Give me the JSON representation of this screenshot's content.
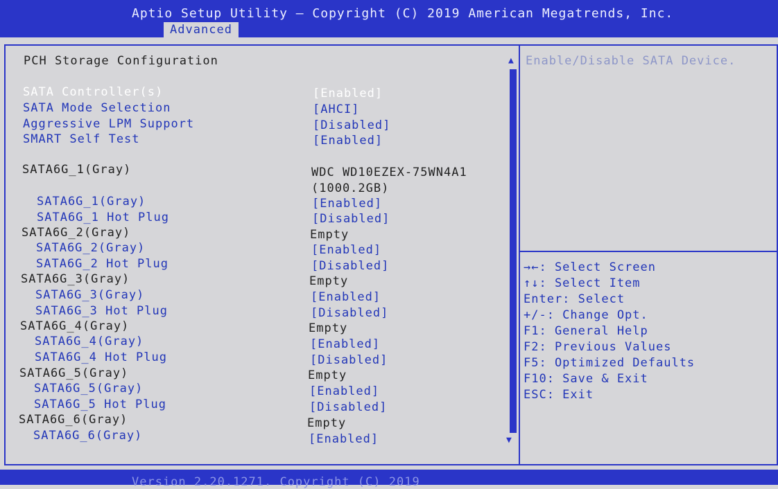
{
  "header": {
    "title": "Aptio Setup Utility – Copyright (C) 2019 American Megatrends, Inc.",
    "active_tab": "Advanced"
  },
  "page": {
    "heading": "PCH Storage Configuration"
  },
  "settings": [
    {
      "label": "SATA Controller(s)",
      "value": "[Enabled]"
    },
    {
      "label": "SATA Mode Selection",
      "value": "[AHCI]"
    },
    {
      "label": "Aggressive LPM Support",
      "value": "[Disabled]"
    },
    {
      "label": "SMART Self Test",
      "value": "[Enabled]"
    },
    {
      "label": "SATA6G_1(Gray)",
      "value": "WDC WD10EZEX-75WN4A1",
      "value2": "(1000.2GB)"
    },
    {
      "label": "SATA6G_1(Gray)",
      "value": "[Enabled]"
    },
    {
      "label": "SATA6G_1 Hot Plug",
      "value": "[Disabled]"
    },
    {
      "label": "SATA6G_2(Gray)",
      "value": "Empty"
    },
    {
      "label": "SATA6G_2(Gray)",
      "value": "[Enabled]"
    },
    {
      "label": "SATA6G_2 Hot Plug",
      "value": "[Disabled]"
    },
    {
      "label": "SATA6G_3(Gray)",
      "value": "Empty"
    },
    {
      "label": "SATA6G_3(Gray)",
      "value": "[Enabled]"
    },
    {
      "label": "SATA6G_3 Hot Plug",
      "value": "[Disabled]"
    },
    {
      "label": "SATA6G_4(Gray)",
      "value": "Empty"
    },
    {
      "label": "SATA6G_4(Gray)",
      "value": "[Enabled]"
    },
    {
      "label": "SATA6G_4 Hot Plug",
      "value": "[Disabled]"
    },
    {
      "label": "SATA6G_5(Gray)",
      "value": "Empty"
    },
    {
      "label": "SATA6G_5(Gray)",
      "value": "[Enabled]"
    },
    {
      "label": "SATA6G_5 Hot Plug",
      "value": "[Disabled]"
    },
    {
      "label": "SATA6G_6(Gray)",
      "value": "Empty"
    },
    {
      "label": "SATA6G_6(Gray)",
      "value": "[Enabled]"
    }
  ],
  "help": {
    "text": "Enable/Disable SATA Device."
  },
  "keys": [
    "→←: Select Screen",
    "↑↓: Select Item",
    "Enter: Select",
    "+/-: Change Opt.",
    "F1: General Help",
    "F2: Previous Values",
    "F5: Optimized Defaults",
    "F10: Save & Exit",
    "ESC: Exit"
  ],
  "footer": {
    "version": "Version 2.20.1271. Copyright (C) 2019"
  },
  "colors": {
    "brand_blue": "#2a35c8",
    "option_text": "#2236b8",
    "background": "#d6d6d9"
  }
}
